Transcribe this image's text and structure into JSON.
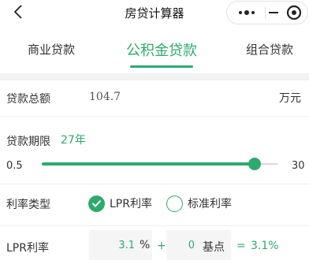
{
  "window": {
    "title": "房贷计算器"
  },
  "tabs": [
    {
      "label": "商业贷款",
      "active": false
    },
    {
      "label": "公积金贷款",
      "active": true
    },
    {
      "label": "组合贷款",
      "active": false
    }
  ],
  "loan_amount": {
    "label": "贷款总额",
    "value": "104.7",
    "unit": "万元"
  },
  "loan_term": {
    "label": "贷款期限",
    "value": "27年",
    "slider_min": "0.5",
    "slider_max": "30",
    "slider_fraction": 0.9
  },
  "rate_type": {
    "label": "利率类型",
    "options": [
      {
        "label": "LPR利率",
        "selected": true
      },
      {
        "label": "标准利率",
        "selected": false
      }
    ]
  },
  "lpr": {
    "label": "LPR利率",
    "rate_value": "3.1",
    "rate_unit": "%",
    "plus": "+",
    "basis_value": "0",
    "basis_unit": "基点",
    "equals": "=",
    "result": "3.1%"
  },
  "colors": {
    "accent": "#2eaa6d",
    "divider": "#f2f2f2"
  }
}
